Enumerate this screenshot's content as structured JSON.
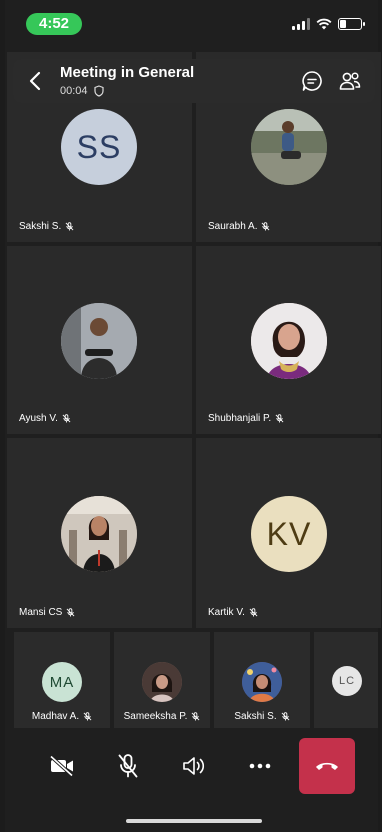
{
  "status_bar": {
    "time": "4:52"
  },
  "header": {
    "title": "Meeting in General",
    "duration": "00:04"
  },
  "participants": [
    {
      "name": "Sakshi S.",
      "initials": "SS",
      "avatar_bg": "#c6cfdc",
      "initials_color": "#2c3e63"
    },
    {
      "name": "Saurabh A.",
      "initials": "",
      "avatar_bg": "#6b7563"
    },
    {
      "name": "Ayush V.",
      "initials": "",
      "avatar_bg": "#8a8f94"
    },
    {
      "name": "Shubhanjali P.",
      "initials": "",
      "avatar_bg": "#d7b7b0"
    },
    {
      "name": "Mansi CS",
      "initials": "",
      "avatar_bg": "#7b6a5e"
    },
    {
      "name": "Kartik V.",
      "initials": "KV",
      "avatar_bg": "#eadfbf",
      "initials_color": "#4e3c14"
    }
  ],
  "thumbnails": [
    {
      "name": "Madhav A.",
      "initials": "MA",
      "avatar_bg": "#c9e3d4",
      "initials_color": "#1f4a33"
    },
    {
      "name": "Sameeksha P.",
      "initials": "",
      "avatar_bg": "#8b6f66"
    },
    {
      "name": "Sakshi S.",
      "initials": "",
      "avatar_bg": "#6e5a8f"
    },
    {
      "name": "",
      "initials": "LC",
      "avatar_bg": "#e6e6e6",
      "initials_color": "#555555"
    }
  ],
  "controls": {
    "icons": [
      "video-off-icon",
      "mic-off-icon",
      "speaker-icon",
      "more-icon",
      "hang-up-icon"
    ]
  },
  "colors": {
    "status_pill": "#36c759",
    "end_call": "#c4314b",
    "tile_bg": "#2a2a2a"
  }
}
